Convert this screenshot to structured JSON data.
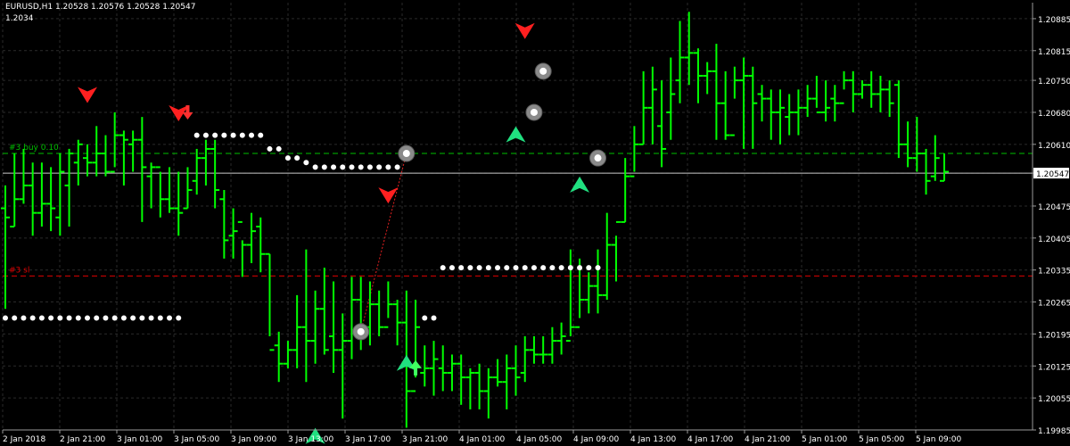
{
  "header": {
    "symbol_line": "EURUSD,H1  1.20528 1.20576 1.20528 1.20547",
    "indicator_value": "1.2034"
  },
  "chart_data": {
    "type": "candlestick",
    "symbol": "EURUSD",
    "timeframe": "H1",
    "ylim": [
      1.19985,
      1.2092
    ],
    "grid": true,
    "y_ticks": [
      "1.20885",
      "1.20815",
      "1.20750",
      "1.20680",
      "1.20610",
      "1.20547",
      "1.20475",
      "1.20405",
      "1.20335",
      "1.20265",
      "1.20195",
      "1.20125",
      "1.20055",
      "1.19985"
    ],
    "current_price": "1.20547",
    "x_ticks": [
      "2 Jan 2018",
      "2 Jan 21:00",
      "3 Jan 01:00",
      "3 Jan 05:00",
      "3 Jan 09:00",
      "3 Jan 13:00",
      "3 Jan 17:00",
      "3 Jan 21:00",
      "4 Jan 01:00",
      "4 Jan 05:00",
      "4 Jan 09:00",
      "4 Jan 13:00",
      "4 Jan 17:00",
      "4 Jan 21:00",
      "5 Jan 01:00",
      "5 Jan 05:00",
      "5 Jan 09:00"
    ],
    "levels": [
      {
        "label": "#3 buy 0.10",
        "price": 1.2059,
        "color": "#00c000",
        "style": "dashed"
      },
      {
        "label": "#3 sl",
        "price": 1.20322,
        "color": "#e00000",
        "style": "dashed"
      },
      {
        "label": "",
        "price": 1.20547,
        "color": "#c8c8c8",
        "style": "solid"
      }
    ],
    "colors": {
      "background": "#000000",
      "grid": "#2a2a2a",
      "bar": "#00ff00",
      "text": "#ffffff",
      "sar": "#ffffff",
      "sell_arrow": "#ff2020",
      "buy_arrow": "#20e080"
    },
    "bars": [
      [
        1.2047,
        1.2052,
        1.2025,
        1.2045
      ],
      [
        1.2043,
        1.2059,
        1.2043,
        1.2049
      ],
      [
        1.2049,
        1.206,
        1.2048,
        1.2052
      ],
      [
        1.2052,
        1.2057,
        1.2041,
        1.2046
      ],
      [
        1.2046,
        1.2057,
        1.2043,
        1.2048
      ],
      [
        1.2048,
        1.2056,
        1.2042,
        1.2047
      ],
      [
        1.2045,
        1.2059,
        1.2041,
        1.2055
      ],
      [
        1.2052,
        1.206,
        1.2043,
        1.2059
      ],
      [
        1.2057,
        1.2062,
        1.2052,
        1.2061
      ],
      [
        1.2058,
        1.2061,
        1.2054,
        1.2057
      ],
      [
        1.2057,
        1.2065,
        1.2054,
        1.2059
      ],
      [
        1.2059,
        1.2063,
        1.2054,
        1.2055
      ],
      [
        1.2055,
        1.2068,
        1.2056,
        1.2063
      ],
      [
        1.2063,
        1.2064,
        1.2052,
        1.2062
      ],
      [
        1.2061,
        1.2064,
        1.2055,
        1.2062
      ],
      [
        1.2062,
        1.2067,
        1.2044,
        1.2056
      ],
      [
        1.2054,
        1.2057,
        1.2047,
        1.2056
      ],
      [
        1.2056,
        1.2055,
        1.2045,
        1.2049
      ],
      [
        1.2049,
        1.2056,
        1.2046,
        1.2047
      ],
      [
        1.2047,
        1.2055,
        1.2041,
        1.2046
      ],
      [
        1.2047,
        1.2056,
        1.2047,
        1.2051
      ],
      [
        1.2053,
        1.206,
        1.205,
        1.2058
      ],
      [
        1.2058,
        1.2062,
        1.2052,
        1.206
      ],
      [
        1.206,
        1.2062,
        1.2047,
        1.2051
      ],
      [
        1.2049,
        1.2051,
        1.2036,
        1.204
      ],
      [
        1.2041,
        1.2047,
        1.2036,
        1.2042
      ],
      [
        1.2044,
        1.204,
        1.2032,
        1.2039
      ],
      [
        1.2039,
        1.2046,
        1.2035,
        1.2042
      ],
      [
        1.2043,
        1.2045,
        1.2033,
        1.2037
      ],
      [
        1.2037,
        1.2037,
        1.2019,
        1.2016
      ],
      [
        1.2017,
        1.202,
        1.2009,
        1.2013
      ],
      [
        1.2013,
        1.2018,
        1.2012,
        1.2016
      ],
      [
        1.2016,
        1.2028,
        1.2012,
        1.2021
      ],
      [
        1.2021,
        1.2038,
        1.2009,
        1.2018
      ],
      [
        1.2018,
        1.2029,
        1.2013,
        1.2025
      ],
      [
        1.2025,
        1.2034,
        1.2015,
        1.2016
      ],
      [
        1.2019,
        1.2031,
        1.2011,
        1.2016
      ],
      [
        1.2016,
        1.2024,
        1.2001,
        1.2018
      ],
      [
        1.2018,
        1.2032,
        1.2014,
        1.2027
      ],
      [
        1.2027,
        1.2032,
        1.2016,
        1.2021
      ],
      [
        1.2021,
        1.2031,
        1.2017,
        1.2026
      ],
      [
        1.2026,
        1.2029,
        1.2019,
        1.2021
      ],
      [
        1.2021,
        1.2031,
        1.2023,
        1.2026
      ],
      [
        1.2026,
        1.2027,
        1.2017,
        1.2022
      ],
      [
        1.2022,
        1.2029,
        1.1999,
        1.2007
      ],
      [
        1.2007,
        1.2027,
        1.201,
        1.2021
      ],
      [
        1.2011,
        1.2017,
        1.2008,
        1.2012
      ],
      [
        1.2012,
        1.2018,
        1.2006,
        1.2014
      ],
      [
        1.2012,
        1.2017,
        1.2007,
        1.2011
      ],
      [
        1.2011,
        1.2015,
        1.2007,
        1.2013
      ],
      [
        1.2013,
        1.2015,
        1.2004,
        1.201
      ],
      [
        1.201,
        1.2012,
        1.2003,
        1.2011
      ],
      [
        1.2011,
        1.2013,
        1.2003,
        1.2007
      ],
      [
        1.2007,
        1.2012,
        1.2001,
        1.201
      ],
      [
        1.201,
        1.2014,
        1.2008,
        1.2009
      ],
      [
        1.2009,
        1.2015,
        1.2003,
        1.2012
      ],
      [
        1.2012,
        1.2017,
        1.2006,
        1.201
      ],
      [
        1.2011,
        1.2019,
        1.2009,
        1.2016
      ],
      [
        1.2016,
        1.2019,
        1.2013,
        1.2015
      ],
      [
        1.2015,
        1.2019,
        1.2013,
        1.2015
      ],
      [
        1.2015,
        1.2021,
        1.2013,
        1.2018
      ],
      [
        1.2018,
        1.2022,
        1.2015,
        1.2019
      ],
      [
        1.2018,
        1.2038,
        1.2019,
        1.2021
      ],
      [
        1.2021,
        1.2036,
        1.2023,
        1.2027
      ],
      [
        1.2027,
        1.2033,
        1.2024,
        1.203
      ],
      [
        1.203,
        1.2038,
        1.2024,
        1.2028
      ],
      [
        1.2028,
        1.2046,
        1.2027,
        1.2039
      ],
      [
        1.2039,
        1.2041,
        1.2031,
        1.2044
      ],
      [
        1.2044,
        1.2058,
        1.2044,
        1.2054
      ],
      [
        1.2054,
        1.2065,
        1.2055,
        1.2061
      ],
      [
        1.2061,
        1.2077,
        1.2061,
        1.2069
      ],
      [
        1.2069,
        1.2078,
        1.2061,
        1.2073
      ],
      [
        1.2065,
        1.2075,
        1.2056,
        1.206
      ],
      [
        1.2068,
        1.208,
        1.2062,
        1.2072
      ],
      [
        1.2075,
        1.2088,
        1.207,
        1.208
      ],
      [
        1.208,
        1.209,
        1.2074,
        1.2081
      ],
      [
        1.2081,
        1.2082,
        1.207,
        1.2076
      ],
      [
        1.2076,
        1.2079,
        1.2072,
        1.2077
      ],
      [
        1.2077,
        1.2083,
        1.2062,
        1.207
      ],
      [
        1.207,
        1.2077,
        1.2062,
        1.2063
      ],
      [
        1.2063,
        1.2078,
        1.2071,
        1.2075
      ],
      [
        1.2075,
        1.208,
        1.206,
        1.2076
      ],
      [
        1.2076,
        1.2078,
        1.206,
        1.207
      ],
      [
        1.2072,
        1.2074,
        1.2066,
        1.2071
      ],
      [
        1.2071,
        1.2073,
        1.2062,
        1.2068
      ],
      [
        1.2068,
        1.2073,
        1.2061,
        1.2069
      ],
      [
        1.2067,
        1.2072,
        1.2063,
        1.2068
      ],
      [
        1.2068,
        1.2073,
        1.2063,
        1.2069
      ],
      [
        1.2069,
        1.2074,
        1.2067,
        1.2071
      ],
      [
        1.2071,
        1.2076,
        1.2069,
        1.2068
      ],
      [
        1.2068,
        1.2075,
        1.2066,
        1.2069
      ],
      [
        1.2071,
        1.2074,
        1.2066,
        1.207
      ],
      [
        1.207,
        1.2077,
        1.2073,
        1.2075
      ],
      [
        1.2075,
        1.2077,
        1.2068,
        1.2072
      ],
      [
        1.2072,
        1.2075,
        1.2071,
        1.2074
      ],
      [
        1.2074,
        1.2077,
        1.2069,
        1.2072
      ],
      [
        1.2072,
        1.2076,
        1.2068,
        1.2073
      ],
      [
        1.2073,
        1.2075,
        1.2067,
        1.207
      ],
      [
        1.2074,
        1.2075,
        1.2058,
        1.2061
      ],
      [
        1.2061,
        1.2066,
        1.2056,
        1.2058
      ],
      [
        1.2058,
        1.2067,
        1.2055,
        1.2059
      ],
      [
        1.2059,
        1.206,
        1.205,
        1.2053
      ],
      [
        1.2054,
        1.2063,
        1.2053,
        1.2058
      ],
      [
        1.2053,
        1.2059,
        1.2053,
        1.2055
      ]
    ],
    "psar": [
      [
        0,
        1.2023
      ],
      [
        1,
        1.2023
      ],
      [
        2,
        1.2023
      ],
      [
        3,
        1.2023
      ],
      [
        4,
        1.2023
      ],
      [
        5,
        1.2023
      ],
      [
        6,
        1.2023
      ],
      [
        7,
        1.2023
      ],
      [
        8,
        1.2023
      ],
      [
        9,
        1.2023
      ],
      [
        10,
        1.2023
      ],
      [
        11,
        1.2023
      ],
      [
        12,
        1.2023
      ],
      [
        13,
        1.2023
      ],
      [
        14,
        1.2023
      ],
      [
        15,
        1.2023
      ],
      [
        16,
        1.2023
      ],
      [
        17,
        1.2023
      ],
      [
        18,
        1.2023
      ],
      [
        19,
        1.2023
      ],
      [
        21,
        1.2063
      ],
      [
        22,
        1.2063
      ],
      [
        23,
        1.2063
      ],
      [
        24,
        1.2063
      ],
      [
        25,
        1.2063
      ],
      [
        26,
        1.2063
      ],
      [
        27,
        1.2063
      ],
      [
        28,
        1.2063
      ],
      [
        29,
        1.206
      ],
      [
        30,
        1.206
      ],
      [
        31,
        1.2058
      ],
      [
        32,
        1.2058
      ],
      [
        33,
        1.2057
      ],
      [
        34,
        1.2056
      ],
      [
        35,
        1.2056
      ],
      [
        36,
        1.2056
      ],
      [
        37,
        1.2056
      ],
      [
        38,
        1.2056
      ],
      [
        39,
        1.2056
      ],
      [
        40,
        1.2056
      ],
      [
        41,
        1.2056
      ],
      [
        42,
        1.2056
      ],
      [
        43,
        1.2056
      ],
      [
        46,
        1.2023
      ],
      [
        47,
        1.2023
      ],
      [
        48,
        1.2034
      ],
      [
        49,
        1.2034
      ],
      [
        50,
        1.2034
      ],
      [
        51,
        1.2034
      ],
      [
        52,
        1.2034
      ],
      [
        53,
        1.2034
      ],
      [
        54,
        1.2034
      ],
      [
        55,
        1.2034
      ],
      [
        56,
        1.2034
      ],
      [
        57,
        1.2034
      ],
      [
        58,
        1.2034
      ],
      [
        59,
        1.2034
      ],
      [
        60,
        1.2034
      ],
      [
        61,
        1.2034
      ],
      [
        62,
        1.2034
      ],
      [
        63,
        1.2034
      ],
      [
        64,
        1.2034
      ],
      [
        65,
        1.2034
      ]
    ],
    "sell_signals": [
      [
        9,
        1.2072
      ],
      [
        19,
        1.2068
      ],
      [
        42,
        1.205
      ],
      [
        57,
        1.2086
      ]
    ],
    "buy_signals": [
      [
        34,
        1.1997
      ],
      [
        44,
        1.2013
      ],
      [
        56,
        1.2063
      ],
      [
        63,
        1.2052
      ]
    ],
    "trade_marks": [
      [
        39,
        1.202
      ],
      [
        44,
        1.2059
      ],
      [
        58,
        1.2068
      ],
      [
        59,
        1.2077
      ],
      [
        65,
        1.2058
      ]
    ]
  }
}
